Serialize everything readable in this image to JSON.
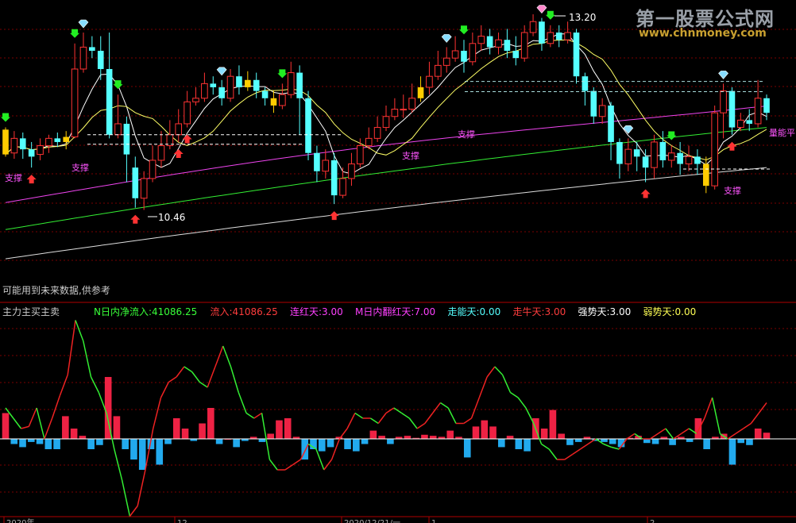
{
  "watermark": {
    "title": "第一股票公式网",
    "url": "www.chnmoney.com"
  },
  "upper": {
    "note": "可能用到未来数据,供参考",
    "high_label": "13.20",
    "low_label": "10.46",
    "support_label": "支撑",
    "right_label": "量能平"
  },
  "lower": {
    "name": "主力主买主卖",
    "readouts": [
      {
        "label": "N日内净流入:",
        "value": "41086.25",
        "color": "#39ff39"
      },
      {
        "label": "流入:",
        "value": "41086.25",
        "color": "#ff3d3d"
      },
      {
        "label": "连红天:",
        "value": "3.00",
        "color": "#ff40ff"
      },
      {
        "label": "M日内翻红天:",
        "value": "7.00",
        "color": "#ff40ff"
      },
      {
        "label": "走能天:",
        "value": "0.00",
        "color": "#55ffff"
      },
      {
        "label": "走牛天:",
        "value": "3.00",
        "color": "#ff3d3d"
      },
      {
        "label": "强势天:",
        "value": "3.00",
        "color": "#ffffff"
      },
      {
        "label": "弱势天:",
        "value": "0.00",
        "color": "#ffff55"
      }
    ]
  },
  "axis": {
    "labels": [
      {
        "text": "2020年",
        "x": 1
      },
      {
        "text": "12",
        "x": 44
      },
      {
        "text": "2020/12/21/一",
        "x": 86
      },
      {
        "text": "1",
        "x": 108
      },
      {
        "text": "2",
        "x": 163
      }
    ]
  },
  "chart_data": [
    {
      "type": "candlestick",
      "title": "",
      "ylim": [
        9.8,
        13.6
      ],
      "high_marker": "13.20",
      "low_marker": "10.46",
      "candles": [
        [
          11.62,
          11.28,
          11.65,
          11.25
        ],
        [
          11.3,
          11.5,
          11.6,
          11.22
        ],
        [
          11.5,
          11.35,
          11.58,
          11.22
        ],
        [
          11.35,
          11.25,
          11.45,
          11.1
        ],
        [
          11.28,
          11.4,
          11.5,
          11.2
        ],
        [
          11.4,
          11.5,
          11.55,
          11.3
        ],
        [
          11.5,
          11.45,
          11.58,
          11.38
        ],
        [
          11.45,
          11.52,
          11.6,
          11.35
        ],
        [
          11.52,
          12.45,
          12.8,
          11.5
        ],
        [
          12.45,
          12.75,
          12.95,
          12.4
        ],
        [
          12.75,
          12.7,
          12.9,
          12.6
        ],
        [
          12.7,
          12.45,
          12.9,
          12.3
        ],
        [
          12.45,
          11.55,
          12.95,
          11.5
        ],
        [
          11.55,
          11.7,
          12.1,
          11.5
        ],
        [
          11.7,
          11.28,
          11.8,
          10.9
        ],
        [
          11.1,
          10.68,
          11.25,
          10.55
        ],
        [
          10.68,
          10.95,
          11.05,
          10.52
        ],
        [
          10.95,
          11.2,
          11.4,
          10.9
        ],
        [
          11.2,
          11.4,
          11.6,
          11.1
        ],
        [
          11.4,
          11.55,
          11.75,
          11.35
        ],
        [
          11.55,
          11.7,
          11.9,
          11.45
        ],
        [
          11.7,
          12.0,
          12.15,
          11.65
        ],
        [
          12.0,
          12.05,
          12.2,
          11.95
        ],
        [
          12.05,
          12.25,
          12.4,
          12.0
        ],
        [
          12.25,
          12.2,
          12.35,
          12.1
        ],
        [
          12.2,
          12.05,
          12.3,
          11.95
        ],
        [
          12.05,
          12.35,
          12.45,
          12.0
        ],
        [
          12.35,
          12.2,
          12.5,
          12.1
        ],
        [
          12.2,
          12.3,
          12.42,
          12.15
        ],
        [
          12.3,
          12.15,
          12.4,
          12.05
        ],
        [
          12.15,
          12.05,
          12.2,
          11.95
        ],
        [
          12.05,
          11.95,
          12.15,
          11.85
        ],
        [
          11.95,
          12.1,
          12.25,
          11.9
        ],
        [
          12.1,
          12.4,
          12.55,
          12.05
        ],
        [
          12.4,
          12.05,
          12.5,
          11.55
        ],
        [
          12.05,
          11.3,
          12.15,
          11.2
        ],
        [
          11.3,
          11.05,
          11.4,
          10.9
        ],
        [
          11.05,
          11.2,
          11.35,
          10.95
        ],
        [
          11.2,
          10.72,
          11.3,
          10.6
        ],
        [
          10.72,
          10.95,
          11.1,
          10.68
        ],
        [
          10.95,
          11.15,
          11.3,
          10.85
        ],
        [
          11.15,
          11.4,
          11.5,
          11.1
        ],
        [
          11.4,
          11.5,
          11.65,
          11.35
        ],
        [
          11.5,
          11.65,
          11.8,
          11.45
        ],
        [
          11.65,
          11.8,
          11.95,
          11.6
        ],
        [
          11.8,
          11.9,
          12.05,
          11.75
        ],
        [
          11.9,
          11.9,
          12.1,
          11.78
        ],
        [
          11.9,
          12.05,
          12.25,
          11.85
        ],
        [
          12.05,
          12.2,
          12.35,
          12.0
        ],
        [
          12.2,
          12.35,
          12.55,
          12.1
        ],
        [
          12.35,
          12.5,
          12.7,
          12.3
        ],
        [
          12.5,
          12.6,
          12.75,
          12.4
        ],
        [
          12.6,
          12.7,
          12.9,
          12.55
        ],
        [
          12.7,
          12.55,
          12.85,
          12.4
        ],
        [
          12.55,
          12.8,
          12.95,
          12.5
        ],
        [
          12.8,
          12.9,
          13.05,
          12.7
        ],
        [
          12.9,
          12.75,
          13.0,
          12.65
        ],
        [
          12.75,
          12.85,
          12.95,
          12.65
        ],
        [
          12.85,
          12.7,
          13.0,
          12.6
        ],
        [
          12.7,
          12.6,
          12.9,
          12.5
        ],
        [
          12.6,
          12.95,
          13.05,
          12.55
        ],
        [
          12.95,
          13.1,
          13.2,
          12.9
        ],
        [
          13.1,
          12.8,
          13.15,
          12.7
        ],
        [
          12.8,
          12.95,
          13.05,
          12.75
        ],
        [
          12.95,
          12.85,
          13.05,
          12.75
        ],
        [
          12.85,
          12.95,
          13.1,
          12.8
        ],
        [
          12.95,
          12.35,
          13.0,
          12.25
        ],
        [
          12.35,
          12.15,
          12.4,
          11.95
        ],
        [
          12.15,
          11.8,
          12.2,
          11.7
        ],
        [
          11.8,
          11.95,
          12.05,
          11.7
        ],
        [
          11.95,
          11.45,
          12.0,
          11.2
        ],
        [
          11.45,
          11.15,
          11.5,
          10.95
        ],
        [
          11.15,
          11.35,
          11.5,
          11.05
        ],
        [
          11.35,
          11.25,
          11.45,
          11.05
        ],
        [
          11.25,
          11.1,
          11.35,
          10.9
        ],
        [
          11.1,
          11.45,
          11.55,
          10.95
        ],
        [
          11.45,
          11.2,
          11.6,
          11.1
        ],
        [
          11.2,
          11.3,
          11.4,
          11.1
        ],
        [
          11.3,
          11.15,
          11.45,
          11.0
        ],
        [
          11.15,
          11.25,
          11.4,
          11.05
        ],
        [
          11.25,
          11.15,
          11.35,
          11.0
        ],
        [
          11.15,
          10.85,
          11.25,
          10.75
        ],
        [
          10.85,
          11.85,
          11.95,
          10.8
        ],
        [
          11.85,
          12.15,
          12.25,
          11.5
        ],
        [
          12.15,
          11.65,
          12.2,
          11.55
        ],
        [
          11.65,
          11.75,
          11.85,
          11.6
        ],
        [
          11.75,
          11.7,
          11.9,
          11.6
        ],
        [
          11.7,
          12.05,
          12.3,
          11.65
        ],
        [
          12.05,
          11.85,
          12.1,
          11.75
        ]
      ],
      "yellow_bars": [
        0,
        7,
        28,
        31,
        48,
        81
      ],
      "buy_arrows": [
        0,
        8,
        13,
        32,
        53,
        63,
        77
      ],
      "sell_arrows": [
        3,
        15,
        20,
        21,
        38,
        74,
        84
      ]
    },
    {
      "type": "bar+line",
      "title": "主力主买主卖",
      "bar_values": [
        25,
        -5,
        -8,
        -3,
        -5,
        -10,
        -10,
        22,
        10,
        3,
        -10,
        -6,
        60,
        22,
        -10,
        -20,
        -30,
        -10,
        -25,
        -5,
        20,
        10,
        -2,
        15,
        30,
        -5,
        0,
        -8,
        -2,
        2,
        -3,
        5,
        18,
        20,
        2,
        -20,
        -10,
        -12,
        -8,
        2,
        -10,
        -12,
        -5,
        8,
        3,
        -5,
        2,
        3,
        1,
        4,
        3,
        2,
        8,
        2,
        -18,
        12,
        18,
        12,
        -8,
        3,
        -10,
        -12,
        20,
        10,
        28,
        5,
        -6,
        -3,
        2,
        -2,
        -3,
        -5,
        -8,
        1,
        3,
        -4,
        -5,
        2,
        -6,
        2,
        -3,
        20,
        -10,
        2,
        5,
        -25,
        -4,
        -6,
        10,
        6
      ],
      "line_values": [
        30,
        20,
        10,
        12,
        30,
        0,
        20,
        42,
        62,
        115,
        95,
        60,
        45,
        25,
        -10,
        -40,
        -75,
        -65,
        -30,
        10,
        40,
        55,
        60,
        70,
        65,
        55,
        50,
        70,
        90,
        70,
        45,
        25,
        20,
        25,
        -20,
        -30,
        -30,
        -25,
        -20,
        -5,
        -10,
        -30,
        -20,
        0,
        10,
        25,
        20,
        20,
        15,
        25,
        30,
        25,
        20,
        10,
        15,
        25,
        35,
        30,
        15,
        15,
        20,
        40,
        60,
        70,
        62,
        45,
        40,
        30,
        15,
        -5,
        -10,
        -20,
        -20,
        -15,
        -10,
        -5,
        0,
        -5,
        -8,
        -10,
        0,
        5,
        0,
        0,
        5,
        10,
        0,
        5,
        10,
        5,
        20,
        40,
        5,
        0,
        5,
        10,
        15,
        25,
        35
      ]
    }
  ]
}
